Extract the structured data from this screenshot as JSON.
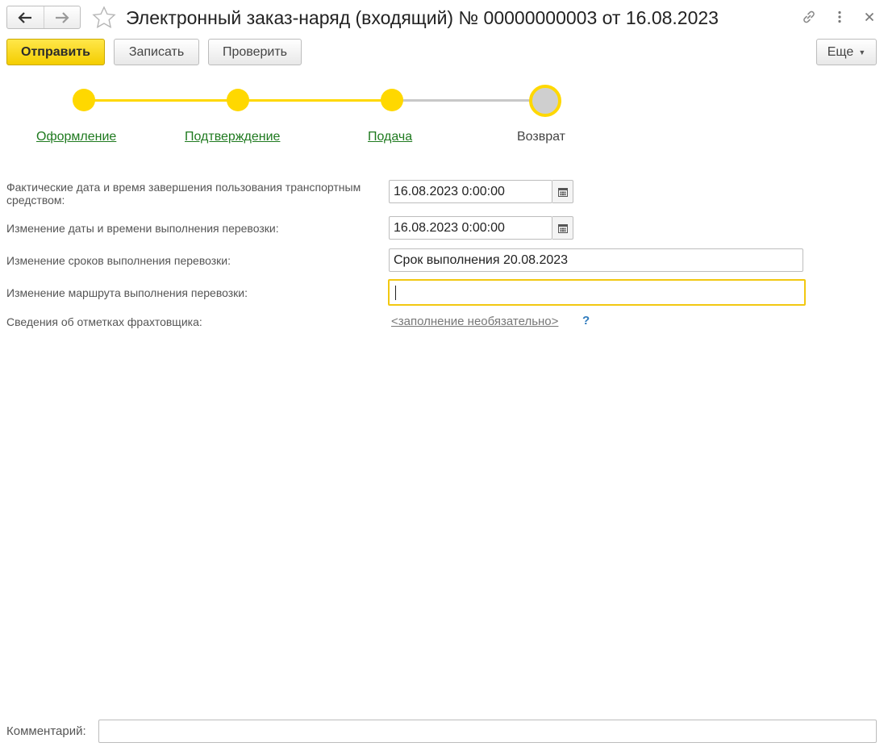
{
  "window": {
    "title": "Электронный заказ-наряд (входящий) № 00000000003 от 16.08.2023"
  },
  "toolbar": {
    "send_label": "Отправить",
    "save_label": "Записать",
    "check_label": "Проверить",
    "more_label": "Еще"
  },
  "steps": [
    {
      "label": "Оформление",
      "state": "done"
    },
    {
      "label": "Подтверждение",
      "state": "done"
    },
    {
      "label": "Подача",
      "state": "done"
    },
    {
      "label": "Возврат",
      "state": "current"
    }
  ],
  "form": {
    "actual_end": {
      "label": "Фактические дата и время завершения пользования транспортным средством:",
      "value": "16.08.2023  0:00:00"
    },
    "change_datetime": {
      "label": "Изменение даты и времени выполнения перевозки:",
      "value": "16.08.2023  0:00:00"
    },
    "change_terms": {
      "label": "Изменение сроков выполнения перевозки:",
      "value": "Срок выполнения 20.08.2023"
    },
    "change_route": {
      "label": "Изменение маршрута выполнения перевозки:",
      "value": ""
    },
    "charterer_notes": {
      "label": "Сведения об отметках фрахтовщика:",
      "link": "<заполнение необязательно>",
      "help": "?"
    },
    "comment": {
      "label": "Комментарий:",
      "value": ""
    }
  },
  "colors": {
    "accent": "#ffd800",
    "link_green": "#1f7a1f",
    "track_inactive": "#c8c8c8"
  }
}
